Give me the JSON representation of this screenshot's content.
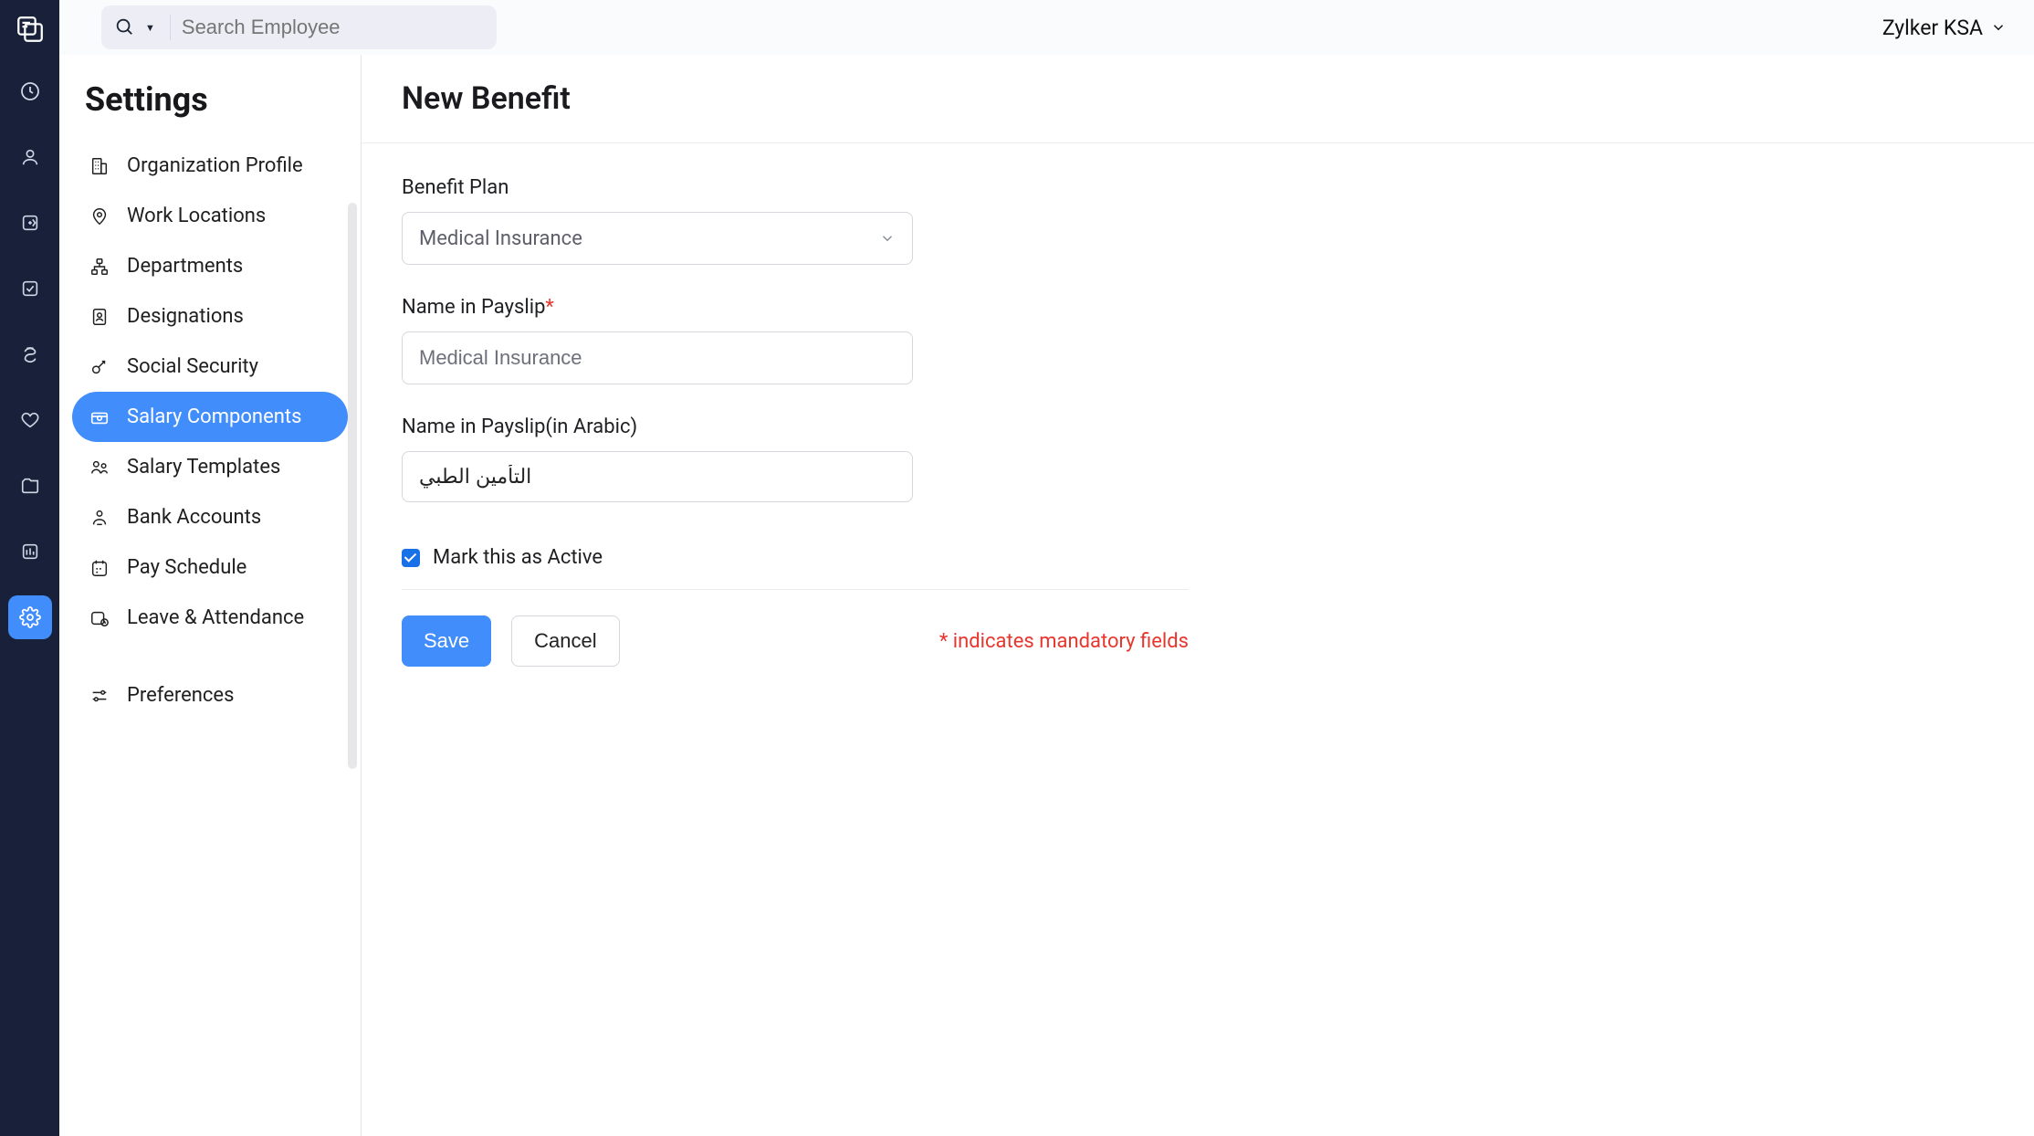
{
  "header": {
    "search_placeholder": "Search Employee",
    "org_name": "Zylker KSA"
  },
  "sidebar": {
    "title": "Settings",
    "items": [
      {
        "label": "Organization Profile",
        "active": false
      },
      {
        "label": "Work Locations",
        "active": false
      },
      {
        "label": "Departments",
        "active": false
      },
      {
        "label": "Designations",
        "active": false
      },
      {
        "label": "Social Security",
        "active": false
      },
      {
        "label": "Salary Components",
        "active": true
      },
      {
        "label": "Salary Templates",
        "active": false
      },
      {
        "label": "Bank Accounts",
        "active": false
      },
      {
        "label": "Pay Schedule",
        "active": false
      },
      {
        "label": "Leave & Attendance",
        "active": false
      },
      {
        "label": "Preferences",
        "active": false
      }
    ]
  },
  "main": {
    "title": "New Benefit",
    "benefit_plan_label": "Benefit Plan",
    "benefit_plan_value": "Medical Insurance",
    "name_payslip_label": "Name in Payslip",
    "name_payslip_value": "Medical Insurance",
    "name_payslip_arabic_label": "Name in Payslip(in Arabic)",
    "name_payslip_arabic_value": "التأمين الطبي",
    "active_label": "Mark this as Active",
    "active_checked": true,
    "save_label": "Save",
    "cancel_label": "Cancel",
    "mandatory_note": "* indicates mandatory fields"
  }
}
